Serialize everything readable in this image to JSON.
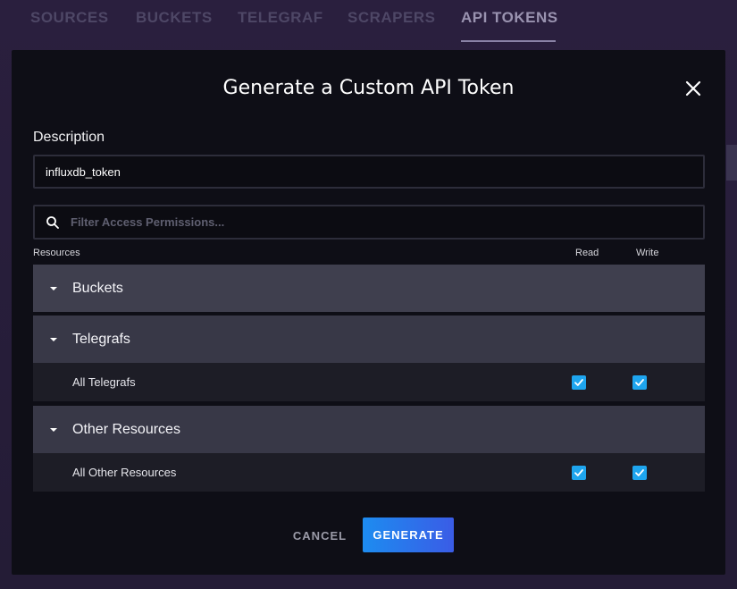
{
  "background_tabs": [
    {
      "label": "SOURCES",
      "active": false
    },
    {
      "label": "BUCKETS",
      "active": false
    },
    {
      "label": "TELEGRAF",
      "active": false
    },
    {
      "label": "SCRAPERS",
      "active": false
    },
    {
      "label": "API TOKENS",
      "active": true
    }
  ],
  "modal": {
    "title": "Generate a Custom API Token",
    "close_icon": "close-icon",
    "description_label": "Description",
    "description_value": "influxdb_token",
    "filter_placeholder": "Filter Access Permissions...",
    "columns": {
      "resources": "Resources",
      "read": "Read",
      "write": "Write"
    },
    "sections": [
      {
        "label": "Buckets",
        "rows": []
      },
      {
        "label": "Telegrafs",
        "rows": [
          {
            "label": "All Telegrafs",
            "read": true,
            "write": true
          }
        ]
      },
      {
        "label": "Other Resources",
        "rows": [
          {
            "label": "All Other Resources",
            "read": true,
            "write": true
          }
        ]
      }
    ],
    "cancel_label": "CANCEL",
    "generate_label": "GENERATE"
  },
  "colors": {
    "accent_checkbox": "#1ea5ee",
    "generate_gradient_start": "#1d8cf0",
    "generate_gradient_end": "#3a5ce6",
    "modal_bg": "#0e0e16"
  }
}
